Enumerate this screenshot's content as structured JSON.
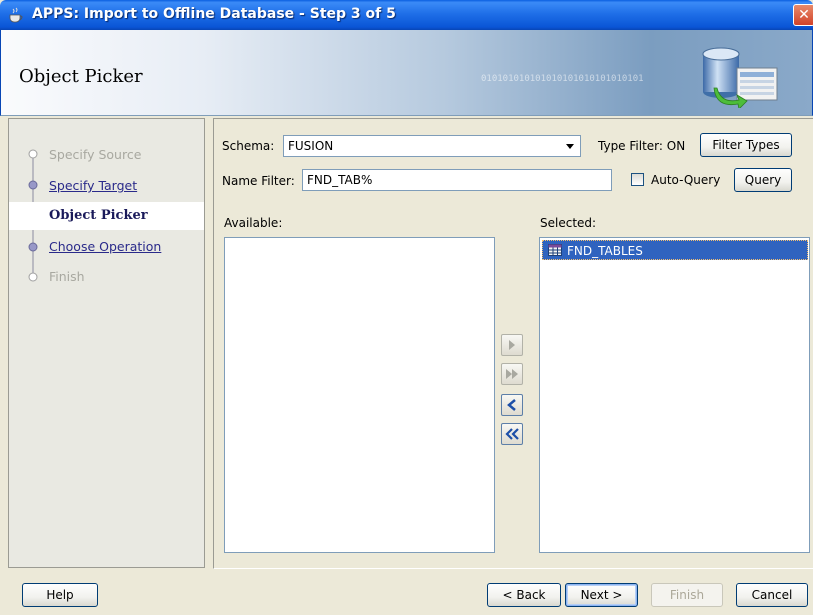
{
  "window": {
    "title": "APPS: Import to Offline Database - Step 3 of 5",
    "close_glyph": "✕"
  },
  "header": {
    "title": "Object Picker",
    "binary_decoration": "010101010101010101010101010101"
  },
  "steps": [
    {
      "label": "Specify Source",
      "state": "disabled"
    },
    {
      "label": "Specify Target",
      "state": "link"
    },
    {
      "label": "Object Picker",
      "state": "current"
    },
    {
      "label": "Choose Operation",
      "state": "link"
    },
    {
      "label": "Finish",
      "state": "disabled"
    }
  ],
  "form": {
    "schema_label": "Schema:",
    "schema_value": "FUSION",
    "type_filter_label": "Type Filter: ON",
    "filter_types_button": "Filter Types",
    "name_filter_label": "Name Filter:",
    "name_filter_value": "FND_TAB%",
    "auto_query_label": "Auto-Query",
    "auto_query_checked": false,
    "query_button": "Query",
    "available_label": "Available:",
    "selected_label": "Selected:"
  },
  "available_items": [],
  "selected_items": [
    {
      "label": "FND_TABLES",
      "icon": "table-icon",
      "selected": true
    }
  ],
  "shuttle": {
    "move_right_enabled": false,
    "move_all_right_enabled": false,
    "move_left_enabled": true,
    "move_all_left_enabled": true
  },
  "footer": {
    "help": "Help",
    "back": "< Back",
    "next": "Next >",
    "finish": "Finish",
    "cancel": "Cancel"
  },
  "colors": {
    "titlebar": "#0a55d6",
    "selection": "#2f63bf",
    "current_step": "#1a1a5a"
  }
}
